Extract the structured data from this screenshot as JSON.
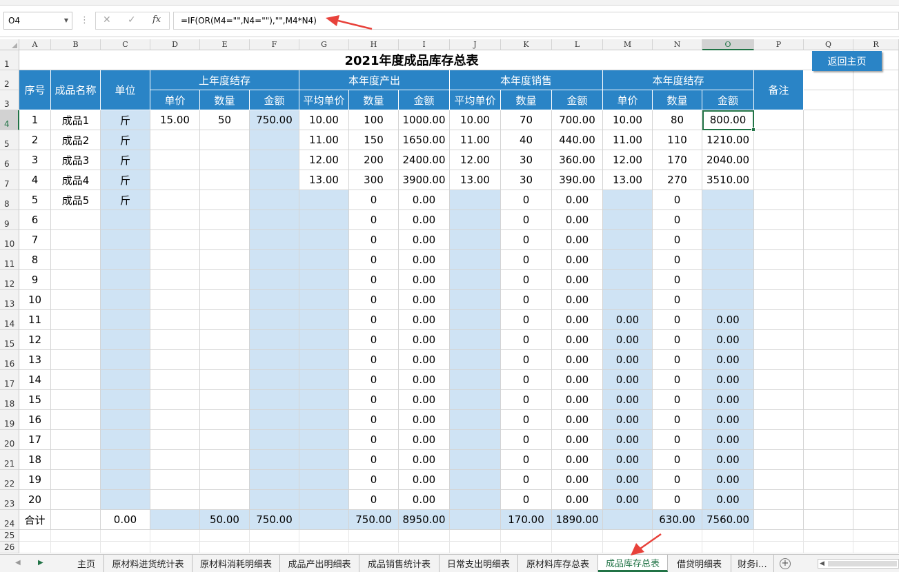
{
  "formula_bar": {
    "name_box": "O4",
    "formula": "=IF(OR(M4=\"\",N4=\"\"),\"\",M4*N4)",
    "cancel_icon": "close-icon",
    "enter_icon": "check-icon",
    "fx_label": "fx"
  },
  "columns": [
    "A",
    "B",
    "C",
    "D",
    "E",
    "F",
    "G",
    "H",
    "I",
    "J",
    "K",
    "L",
    "M",
    "N",
    "O",
    "P",
    "Q",
    "R"
  ],
  "active_column": "O",
  "active_row": 4,
  "sheet": {
    "title": "2021年度成品库存总表",
    "header_row1": {
      "seq": "序号",
      "name": "成品名称",
      "unit": "单位",
      "prev": "上年度结存",
      "prod": "本年度产出",
      "sales": "本年度销售",
      "curr": "本年度结存",
      "remark": "备注"
    },
    "header_row2": [
      "单价",
      "数量",
      "金额",
      "平均单价",
      "数量",
      "金额",
      "平均单价",
      "数量",
      "金额",
      "单价",
      "数量",
      "金额"
    ],
    "rows": [
      [
        "1",
        "成品1",
        "斤",
        "15.00",
        "50",
        "750.00",
        "10.00",
        "100",
        "1000.00",
        "10.00",
        "70",
        "700.00",
        "10.00",
        "80",
        "800.00",
        ""
      ],
      [
        "2",
        "成品2",
        "斤",
        "",
        "",
        "",
        "11.00",
        "150",
        "1650.00",
        "11.00",
        "40",
        "440.00",
        "11.00",
        "110",
        "1210.00",
        ""
      ],
      [
        "3",
        "成品3",
        "斤",
        "",
        "",
        "",
        "12.00",
        "200",
        "2400.00",
        "12.00",
        "30",
        "360.00",
        "12.00",
        "170",
        "2040.00",
        ""
      ],
      [
        "4",
        "成品4",
        "斤",
        "",
        "",
        "",
        "13.00",
        "300",
        "3900.00",
        "13.00",
        "30",
        "390.00",
        "13.00",
        "270",
        "3510.00",
        ""
      ],
      [
        "5",
        "成品5",
        "斤",
        "",
        "",
        "",
        "",
        "0",
        "0.00",
        "",
        "0",
        "0.00",
        "",
        "0",
        "",
        ""
      ],
      [
        "6",
        "",
        "",
        "",
        "",
        "",
        "",
        "0",
        "0.00",
        "",
        "0",
        "0.00",
        "",
        "0",
        "",
        ""
      ],
      [
        "7",
        "",
        "",
        "",
        "",
        "",
        "",
        "0",
        "0.00",
        "",
        "0",
        "0.00",
        "",
        "0",
        "",
        ""
      ],
      [
        "8",
        "",
        "",
        "",
        "",
        "",
        "",
        "0",
        "0.00",
        "",
        "0",
        "0.00",
        "",
        "0",
        "",
        ""
      ],
      [
        "9",
        "",
        "",
        "",
        "",
        "",
        "",
        "0",
        "0.00",
        "",
        "0",
        "0.00",
        "",
        "0",
        "",
        ""
      ],
      [
        "10",
        "",
        "",
        "",
        "",
        "",
        "",
        "0",
        "0.00",
        "",
        "0",
        "0.00",
        "",
        "0",
        "",
        ""
      ],
      [
        "11",
        "",
        "",
        "",
        "",
        "",
        "",
        "0",
        "0.00",
        "",
        "0",
        "0.00",
        "0.00",
        "0",
        "0.00",
        ""
      ],
      [
        "12",
        "",
        "",
        "",
        "",
        "",
        "",
        "0",
        "0.00",
        "",
        "0",
        "0.00",
        "0.00",
        "0",
        "0.00",
        ""
      ],
      [
        "13",
        "",
        "",
        "",
        "",
        "",
        "",
        "0",
        "0.00",
        "",
        "0",
        "0.00",
        "0.00",
        "0",
        "0.00",
        ""
      ],
      [
        "14",
        "",
        "",
        "",
        "",
        "",
        "",
        "0",
        "0.00",
        "",
        "0",
        "0.00",
        "0.00",
        "0",
        "0.00",
        ""
      ],
      [
        "15",
        "",
        "",
        "",
        "",
        "",
        "",
        "0",
        "0.00",
        "",
        "0",
        "0.00",
        "0.00",
        "0",
        "0.00",
        ""
      ],
      [
        "16",
        "",
        "",
        "",
        "",
        "",
        "",
        "0",
        "0.00",
        "",
        "0",
        "0.00",
        "0.00",
        "0",
        "0.00",
        ""
      ],
      [
        "17",
        "",
        "",
        "",
        "",
        "",
        "",
        "0",
        "0.00",
        "",
        "0",
        "0.00",
        "0.00",
        "0",
        "0.00",
        ""
      ],
      [
        "18",
        "",
        "",
        "",
        "",
        "",
        "",
        "0",
        "0.00",
        "",
        "0",
        "0.00",
        "0.00",
        "0",
        "0.00",
        ""
      ],
      [
        "19",
        "",
        "",
        "",
        "",
        "",
        "",
        "0",
        "0.00",
        "",
        "0",
        "0.00",
        "0.00",
        "0",
        "0.00",
        ""
      ],
      [
        "20",
        "",
        "",
        "",
        "",
        "",
        "",
        "0",
        "0.00",
        "",
        "0",
        "0.00",
        "0.00",
        "0",
        "0.00",
        ""
      ]
    ],
    "total_row": [
      "合计",
      "",
      "0.00",
      "",
      "50.00",
      "750.00",
      "",
      "750.00",
      "8950.00",
      "",
      "170.00",
      "1890.00",
      "",
      "630.00",
      "7560.00",
      ""
    ]
  },
  "home_button": "返回主页",
  "sheet_tabs": [
    "主页",
    "原材料进货统计表",
    "原材料消耗明细表",
    "成品产出明细表",
    "成品销售统计表",
    "日常支出明细表",
    "原材料库存总表",
    "成品库存总表",
    "借贷明细表",
    "财务i…"
  ],
  "active_tab": "成品库存总表",
  "colors": {
    "header_blue": "#2a84c6",
    "light_blue": "#cfe3f4",
    "excel_green": "#217346",
    "arrow_red": "#e8423b"
  }
}
